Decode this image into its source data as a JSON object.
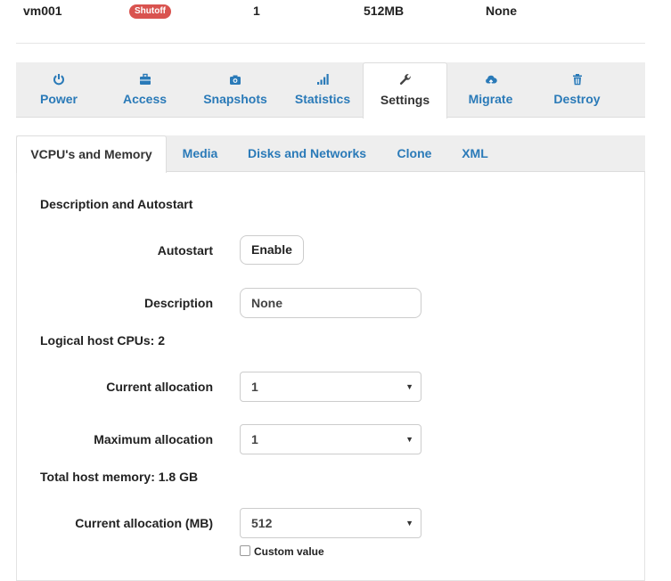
{
  "vm_summary": {
    "name": "vm001",
    "status": "Shutoff",
    "vcpu": "1",
    "memory": "512MB",
    "description": "None",
    "status_color": "#d9534f"
  },
  "main_tabs": [
    {
      "label": "Power",
      "icon": "power-icon"
    },
    {
      "label": "Access",
      "icon": "briefcase-icon"
    },
    {
      "label": "Snapshots",
      "icon": "camera-icon"
    },
    {
      "label": "Statistics",
      "icon": "signal-icon"
    },
    {
      "label": "Settings",
      "icon": "wrench-icon",
      "active": true
    },
    {
      "label": "Migrate",
      "icon": "cloud-upload-icon"
    },
    {
      "label": "Destroy",
      "icon": "trash-icon"
    }
  ],
  "sub_tabs": [
    {
      "label": "VCPU's and Memory",
      "active": true
    },
    {
      "label": "Media"
    },
    {
      "label": "Disks and Networks"
    },
    {
      "label": "Clone"
    },
    {
      "label": "XML"
    }
  ],
  "settings": {
    "description_section": "Description and Autostart",
    "autostart_label": "Autostart",
    "autostart_button": "Enable",
    "description_label": "Description",
    "description_value": "None",
    "cpu_section": "Logical host CPUs: 2",
    "cpu_current_label": "Current allocation",
    "cpu_current_value": "1",
    "cpu_max_label": "Maximum allocation",
    "cpu_max_value": "1",
    "memory_section": "Total host memory: 1.8 GB",
    "mem_current_label": "Current allocation (MB)",
    "mem_current_value": "512",
    "custom_value_label": "Custom value",
    "custom_value_checked": false
  },
  "colors": {
    "link": "#2a7ab8",
    "tab_bar": "#eeeeee"
  }
}
